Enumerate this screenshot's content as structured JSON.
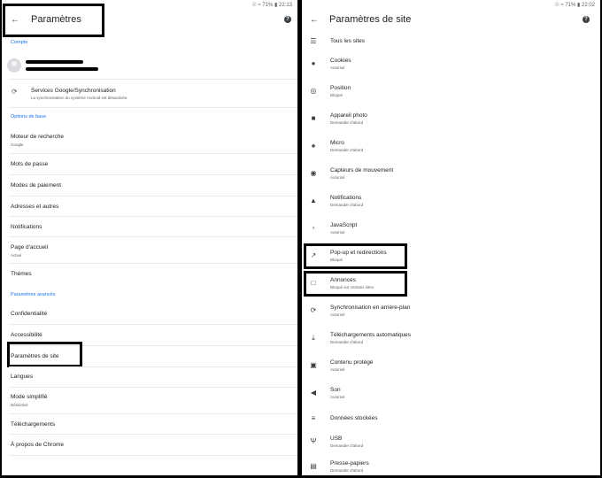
{
  "status": {
    "left_panel": "☉ ≈ 71% ▮ 22:13",
    "right_panel": "☉ ≈ 71% ▮ 22:02"
  },
  "left": {
    "title": "Paramètres",
    "section_account": "Compte",
    "sync": {
      "title": "Services Google/Synchronisation",
      "subtitle": "La synchronisation du système Android est désactivée."
    },
    "section_basics": "Options de base",
    "basics": [
      {
        "title": "Moteur de recherche",
        "subtitle": "Google"
      },
      {
        "title": "Mots de passe",
        "subtitle": ""
      },
      {
        "title": "Modes de paiement",
        "subtitle": ""
      },
      {
        "title": "Adresses et autres",
        "subtitle": ""
      },
      {
        "title": "Notifications",
        "subtitle": ""
      },
      {
        "title": "Page d'accueil",
        "subtitle": "Activé"
      },
      {
        "title": "Thèmes",
        "subtitle": ""
      }
    ],
    "section_advanced": "Paramètres avancés",
    "advanced": [
      {
        "title": "Confidentialité",
        "subtitle": ""
      },
      {
        "title": "Accessibilité",
        "subtitle": ""
      },
      {
        "title": "Paramètres de site",
        "subtitle": ""
      },
      {
        "title": "Langues",
        "subtitle": ""
      },
      {
        "title": "Mode simplifié",
        "subtitle": "Désactivé"
      },
      {
        "title": "Téléchargements",
        "subtitle": ""
      },
      {
        "title": "À propos de Chrome",
        "subtitle": ""
      }
    ]
  },
  "right": {
    "title": "Paramètres de site",
    "items": [
      {
        "icon": "list-icon",
        "glyph": "☰",
        "title": "Tous les sites",
        "subtitle": ""
      },
      {
        "icon": "cookie-icon",
        "glyph": "●",
        "title": "Cookies",
        "subtitle": "Autorisé"
      },
      {
        "icon": "location-icon",
        "glyph": "◎",
        "title": "Position",
        "subtitle": "Bloqué"
      },
      {
        "icon": "camera-icon",
        "glyph": "■",
        "title": "Appareil photo",
        "subtitle": "Demander d'abord"
      },
      {
        "icon": "mic-icon",
        "glyph": "♠",
        "title": "Micro",
        "subtitle": "Demander d'abord"
      },
      {
        "icon": "motion-sensor-icon",
        "glyph": "◉",
        "title": "Capteurs de mouvement",
        "subtitle": "Autorisé"
      },
      {
        "icon": "bell-icon",
        "glyph": "▲",
        "title": "Notifications",
        "subtitle": "Demander d'abord"
      },
      {
        "icon": "javascript-icon",
        "glyph": "▫",
        "title": "JavaScript",
        "subtitle": "Autorisé"
      },
      {
        "icon": "popup-icon",
        "glyph": "↗",
        "title": "Pop-up et redirections",
        "subtitle": "Bloqué"
      },
      {
        "icon": "ads-icon",
        "glyph": "□",
        "title": "Annonces",
        "subtitle": "Bloqué sur certains sites"
      },
      {
        "icon": "sync-icon",
        "glyph": "⟳",
        "title": "Synchronisation en arrière-plan",
        "subtitle": "Autorisé"
      },
      {
        "icon": "download-icon",
        "glyph": "⤓",
        "title": "Téléchargements automatiques",
        "subtitle": "Demander d'abord"
      },
      {
        "icon": "protected-content-icon",
        "glyph": "▣",
        "title": "Contenu protégé",
        "subtitle": "Autorisé"
      },
      {
        "icon": "sound-icon",
        "glyph": "◀",
        "title": "Son",
        "subtitle": "Autorisé"
      },
      {
        "icon": "storage-icon",
        "glyph": "≡",
        "title": "Données stockées",
        "subtitle": ""
      },
      {
        "icon": "usb-icon",
        "glyph": "Ψ",
        "title": "USB",
        "subtitle": "Demander d'abord"
      },
      {
        "icon": "clipboard-icon",
        "glyph": "▤",
        "title": "Presse-papiers",
        "subtitle": "Demander d'abord"
      }
    ]
  }
}
